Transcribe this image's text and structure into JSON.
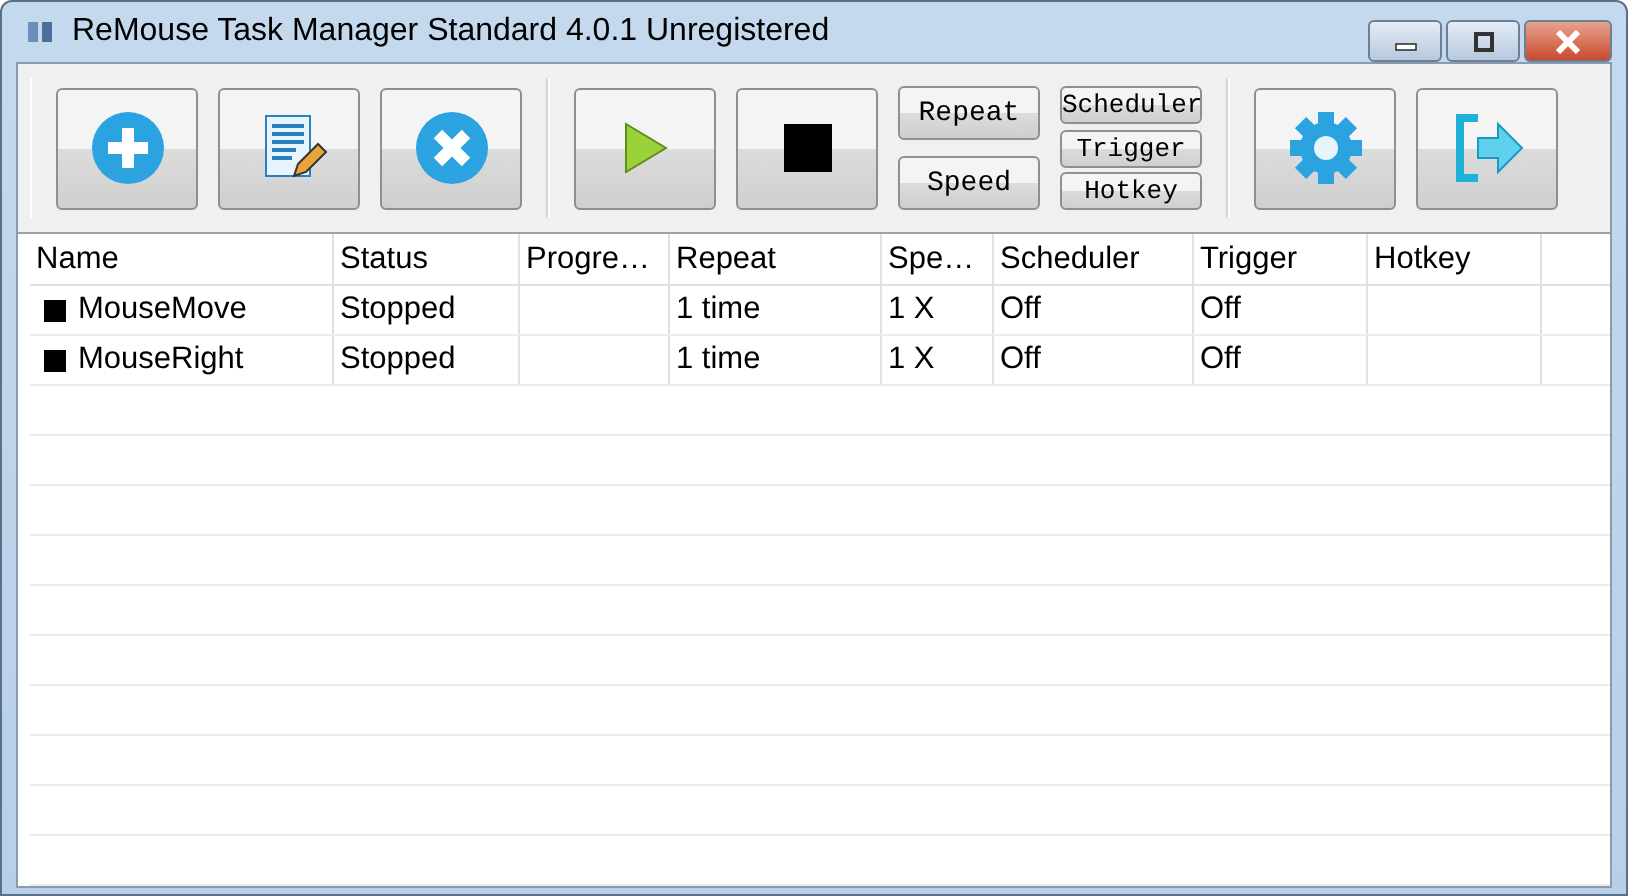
{
  "window": {
    "title": "ReMouse Task Manager Standard 4.0.1 Unregistered"
  },
  "toolbar": {
    "option_buttons": [
      {
        "label": "Repeat",
        "kind": "large"
      },
      {
        "label": "Speed",
        "kind": "large"
      },
      {
        "label": "Scheduler",
        "kind": "small"
      },
      {
        "label": "Trigger",
        "kind": "small"
      },
      {
        "label": "Hotkey",
        "kind": "small"
      }
    ]
  },
  "table": {
    "columns": [
      "Name",
      "Status",
      "Progre…",
      "Repeat",
      "Spe…",
      "Scheduler",
      "Trigger",
      "Hotkey"
    ],
    "rows": [
      {
        "name": "MouseMove",
        "status": "Stopped",
        "repeat": "1 time",
        "speed": "1 X",
        "scheduler": "Off",
        "trigger": "Off"
      },
      {
        "name": "MouseRight",
        "status": "Stopped",
        "repeat": "1 time",
        "speed": "1 X",
        "scheduler": "Off",
        "trigger": "Off"
      }
    ]
  }
}
